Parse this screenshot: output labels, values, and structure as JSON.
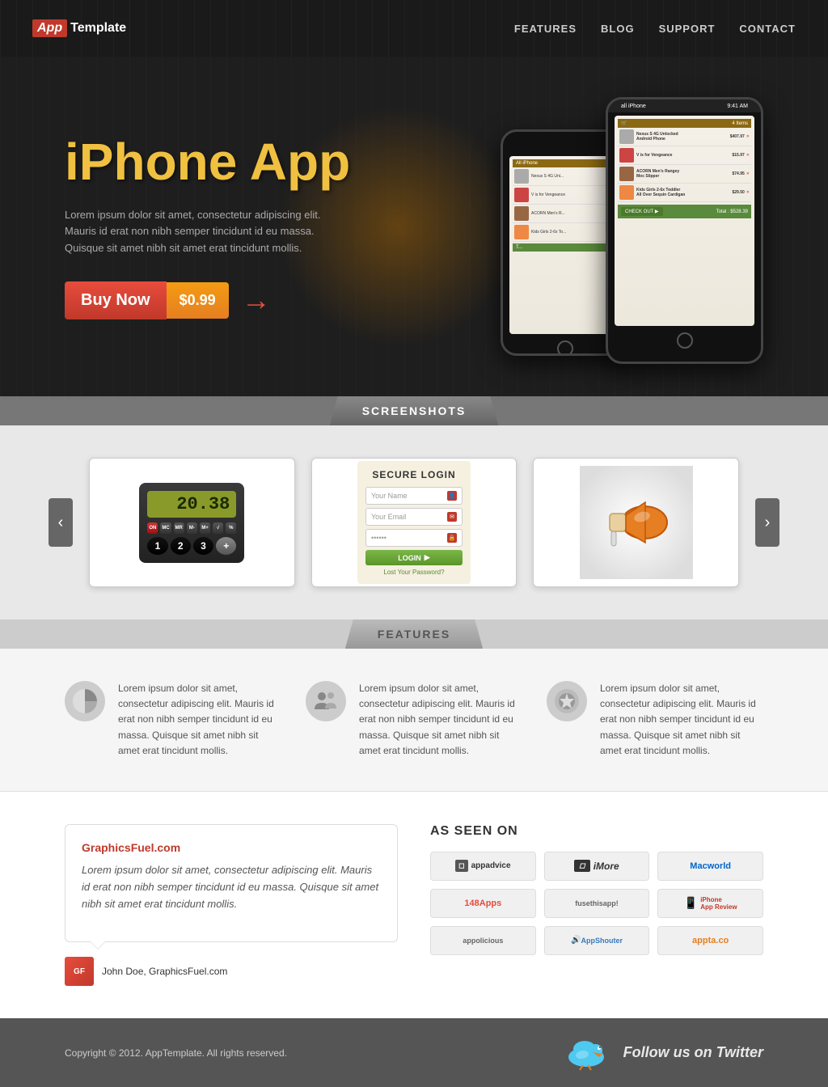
{
  "header": {
    "logo_app": "App",
    "logo_template": "Template",
    "nav": [
      "FEATURES",
      "BLOG",
      "SUPPORT",
      "CONTACT"
    ]
  },
  "hero": {
    "title": "iPhone App",
    "description": "Lorem ipsum dolor sit amet, consectetur adipiscing elit.\nMauris id erat non nibh semper tincidunt id eu massa.\nQuisque sit amet nibh sit amet erat tincidunt mollis.",
    "buy_label": "Buy Now",
    "buy_price": "$0.99",
    "cart_items": [
      {
        "name": "Nexus S 4G Unlocked Android Phone",
        "price": "$407.97"
      },
      {
        "name": "V is for Vengeance",
        "price": "$15.97"
      },
      {
        "name": "ACORN Men's Rangey Moc Slipper",
        "price": "$74.95"
      },
      {
        "name": "Kids Girls 2-6x Toddler All Over Sequin Cardigan",
        "price": "$29.50"
      }
    ],
    "cart_total": "Total : $528.39",
    "cart_count": "4 Items",
    "checkout_label": "CHECK OUT"
  },
  "screenshots": {
    "section_label": "SCREENSHOTS",
    "prev_arrow": "‹",
    "next_arrow": "›",
    "calc_display": "20.38",
    "login_title": "SECURE LOGIN",
    "login_name_placeholder": "Your Name",
    "login_email_placeholder": "Your Email",
    "login_pass_placeholder": "••••••",
    "login_btn": "LOGIN",
    "login_forgot": "Lost Your Password?"
  },
  "features": {
    "section_label": "FEATURES",
    "items": [
      "Lorem ipsum dolor sit amet, consectetur adipiscing elit. Mauris id erat non nibh semper tincidunt id eu massa. Quisque sit amet nibh sit amet erat tincidunt mollis.",
      "Lorem ipsum dolor sit amet, consectetur adipiscing elit. Mauris id erat non nibh semper tincidunt id eu massa. Quisque sit amet nibh sit amet erat tincidunt mollis.",
      "Lorem ipsum dolor sit amet, consectetur adipiscing elit. Mauris id erat non nibh semper tincidunt id eu massa. Quisque sit amet nibh sit amet erat tincidunt mollis."
    ]
  },
  "testimonial": {
    "site": "GraphicsFuel.com",
    "text": "Lorem ipsum dolor sit amet, consectetur adipiscing elit. Mauris id erat non nibh semper tincidunt id eu massa. Quisque sit amet nibh sit amet erat tincidunt mollis.",
    "author": "John Doe, GraphicsFuel.com",
    "avatar_initials": "GF"
  },
  "as_seen_on": {
    "heading": "AS SEEN ON",
    "logos": [
      {
        "name": "appadvice",
        "label": "appadvice"
      },
      {
        "name": "imore",
        "label": "iMore"
      },
      {
        "name": "macworld",
        "label": "Macworld"
      },
      {
        "name": "148apps",
        "label": "148Apps"
      },
      {
        "name": "fusethisapp",
        "label": "fusethisapp!"
      },
      {
        "name": "iphone-review",
        "label": "iPhone App Review"
      },
      {
        "name": "appolicious",
        "label": "appolicious"
      },
      {
        "name": "appshouter",
        "label": "AppShouter"
      },
      {
        "name": "apptaco",
        "label": "appta.co"
      }
    ]
  },
  "footer": {
    "copyright": "Copyright © 2012. AppTemplate. All rights reserved.",
    "twitter_label": "Follow us on Twitter"
  }
}
